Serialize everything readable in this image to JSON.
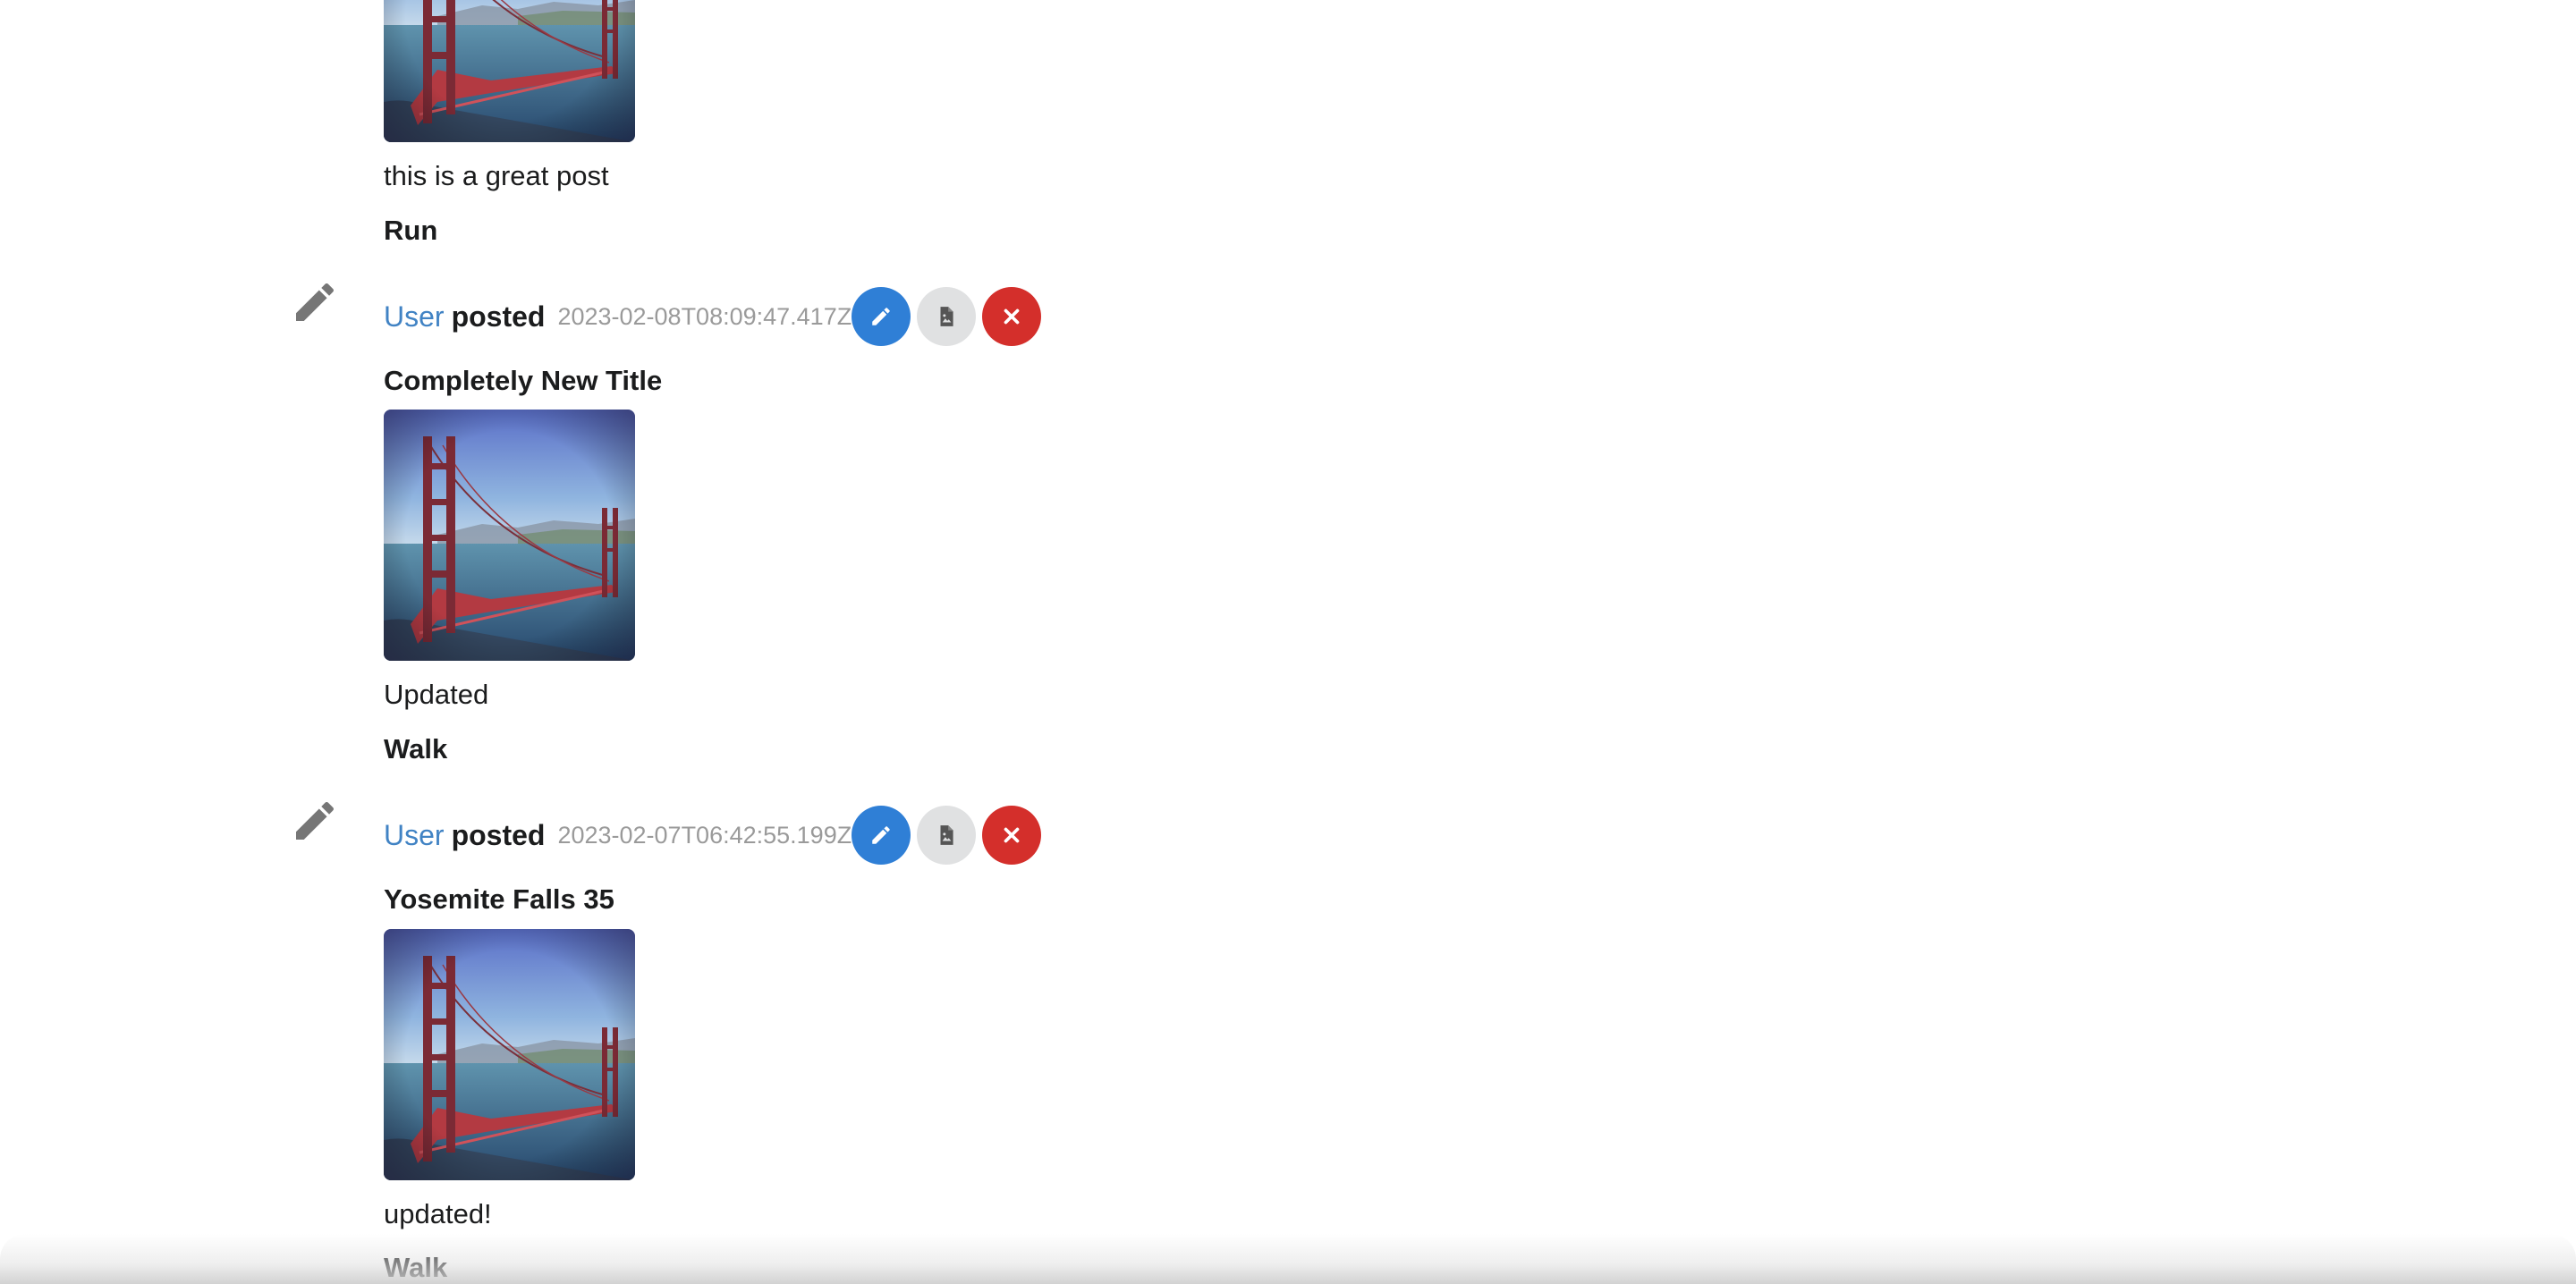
{
  "colors": {
    "link": "#4183c4",
    "edit_button": "#2f7fd6",
    "file_button": "#e0e1e2",
    "delete_button": "#d42f2b",
    "muted_text": "#9a9a9a"
  },
  "posts": [
    {
      "image": "golden-gate-bridge-photo",
      "description": "this is a great post",
      "tag": "Run"
    },
    {
      "event_icon": "pencil-icon",
      "user": "User",
      "action": "posted",
      "date": "2023-02-08T08:09:47.417Z",
      "title": "Completely New Title",
      "image": "golden-gate-bridge-photo",
      "description": "Updated",
      "tag": "Walk",
      "buttons": {
        "edit": "pencil-icon",
        "file": "file-image-icon",
        "delete": "close-icon"
      }
    },
    {
      "event_icon": "pencil-icon",
      "user": "User",
      "action": "posted",
      "date": "2023-02-07T06:42:55.199Z",
      "title": "Yosemite Falls 35",
      "image": "golden-gate-bridge-photo",
      "description": "updated!",
      "tag": "Walk",
      "buttons": {
        "edit": "pencil-icon",
        "file": "file-image-icon",
        "delete": "close-icon"
      }
    }
  ]
}
